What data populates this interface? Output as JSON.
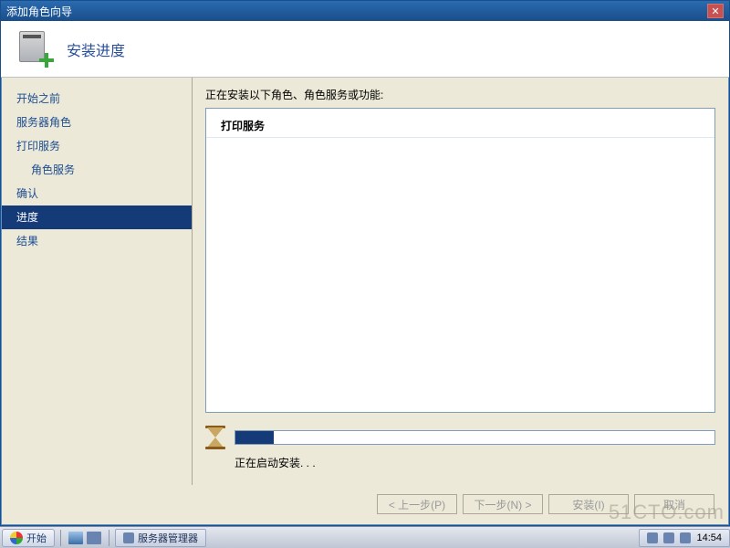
{
  "window": {
    "title": "添加角色向导"
  },
  "header": {
    "title": "安装进度"
  },
  "nav": {
    "items": [
      {
        "label": "开始之前",
        "indent": false
      },
      {
        "label": "服务器角色",
        "indent": false
      },
      {
        "label": "打印服务",
        "indent": false
      },
      {
        "label": "角色服务",
        "indent": true
      },
      {
        "label": "确认",
        "indent": false
      },
      {
        "label": "进度",
        "indent": false,
        "selected": true
      },
      {
        "label": "结果",
        "indent": false
      }
    ]
  },
  "main": {
    "desc": "正在安装以下角色、角色服务或功能:",
    "list_header": "打印服务",
    "status": "正在启动安装. . .",
    "progress_percent": 8
  },
  "buttons": {
    "prev": "< 上一步(P)",
    "next": "下一步(N) >",
    "install": "安装(I)",
    "cancel": "取消"
  },
  "taskbar": {
    "start": "开始",
    "app": "服务器管理器",
    "time": "14:54"
  },
  "watermark": "51CTO.com"
}
